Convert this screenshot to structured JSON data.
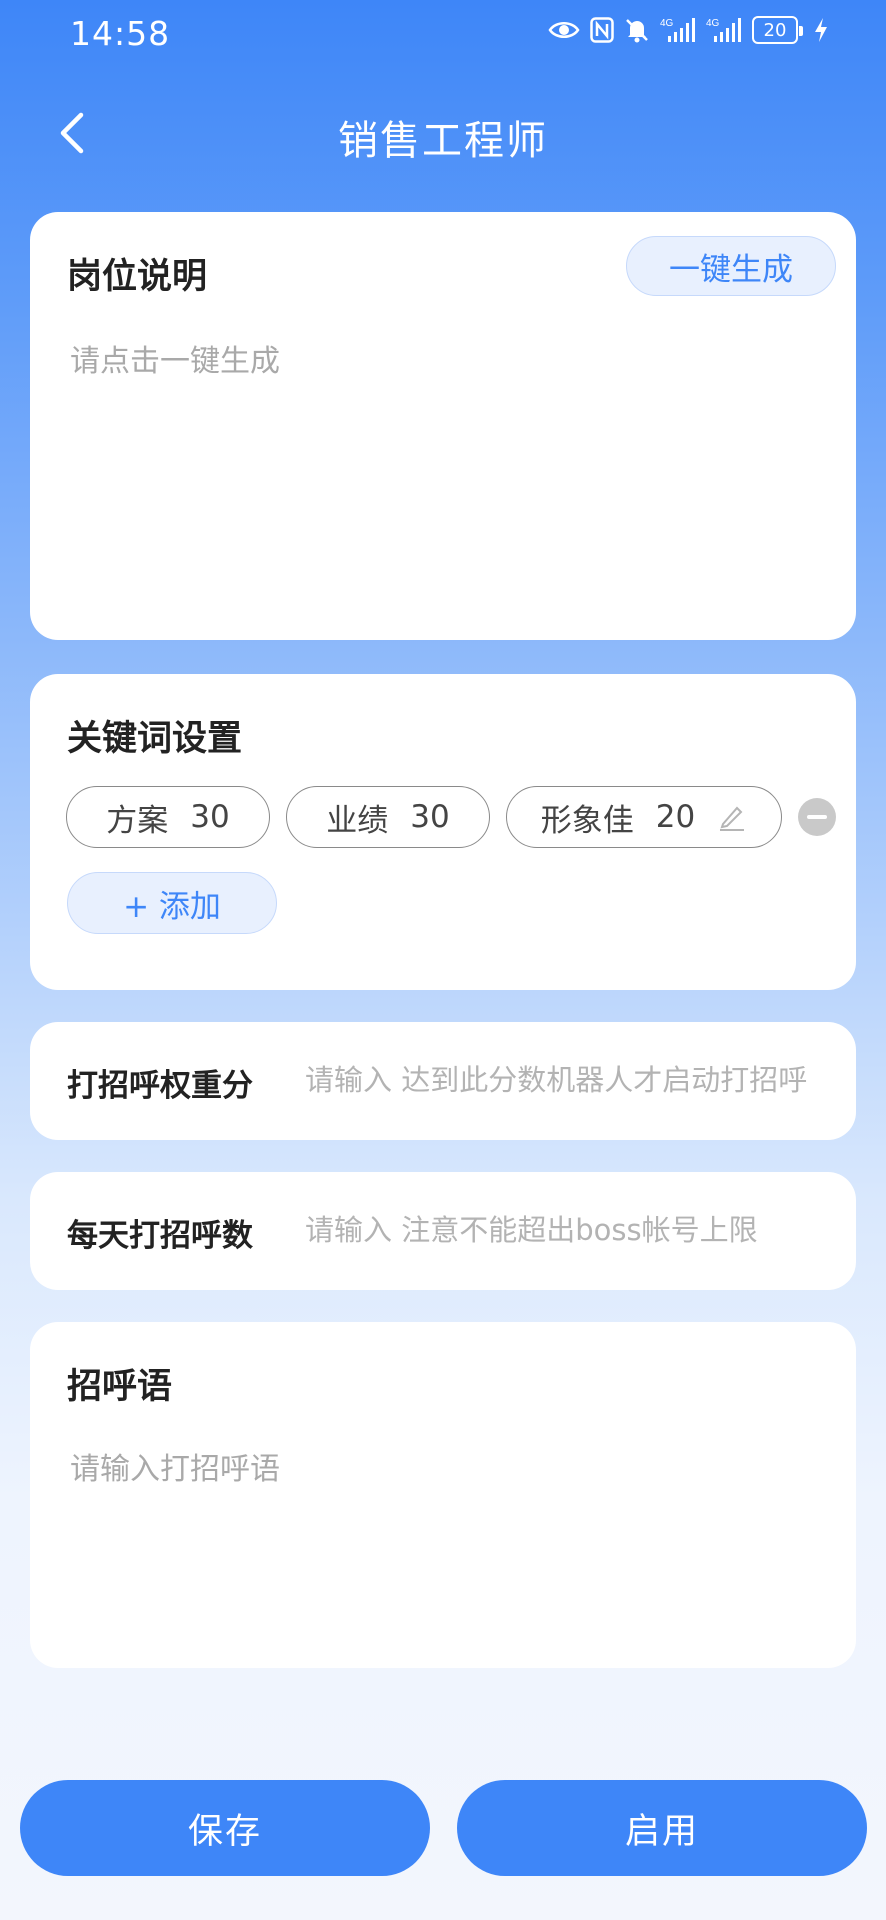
{
  "status_bar": {
    "time": "14:58",
    "network_1": "4G",
    "network_2": "4G",
    "battery": "20"
  },
  "header": {
    "title": "销售工程师"
  },
  "job_description": {
    "title": "岗位说明",
    "generate_label": "一键生成",
    "placeholder": "请点击一键生成"
  },
  "keywords": {
    "title": "关键词设置",
    "items": [
      {
        "name": "方案",
        "score": "30"
      },
      {
        "name": "业绩",
        "score": "30"
      },
      {
        "name": "形象佳",
        "score": "20"
      }
    ],
    "add_label": "+ 添加"
  },
  "threshold": {
    "label": "打招呼权重分",
    "placeholder": "请输入 达到此分数机器人才启动打招呼"
  },
  "daily_count": {
    "label": "每天打招呼数",
    "placeholder": "请输入 注意不能超出boss帐号上限"
  },
  "greeting": {
    "title": "招呼语",
    "placeholder": "请输入打招呼语"
  },
  "actions": {
    "save_label": "保存",
    "enable_label": "启用"
  },
  "colors": {
    "accent": "#3e86f8",
    "light_accent": "#e8f0fe"
  }
}
